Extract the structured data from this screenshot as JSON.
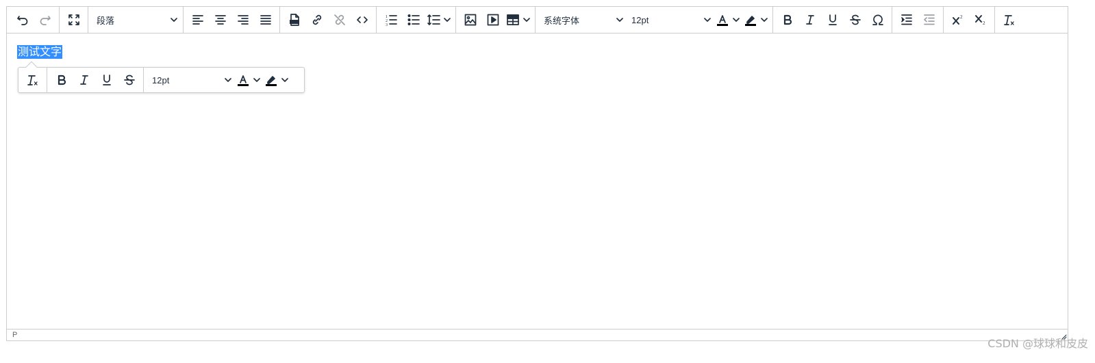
{
  "toolbar": {
    "block_format": "段落",
    "font_family": "系统字体",
    "font_size": "12pt"
  },
  "editor": {
    "selected_text": "测试文字"
  },
  "quickbar": {
    "font_size": "12pt"
  },
  "statusbar": {
    "path": "P"
  },
  "watermark": "CSDN @球球和皮皮",
  "colors": {
    "accent": "#338fff",
    "border": "#cccccc",
    "icon": "#222f3e"
  },
  "icons": [
    "undo-icon",
    "redo-icon",
    "fullscreen-icon",
    "align-left-icon",
    "align-center-icon",
    "align-right-icon",
    "align-justify-icon",
    "pdf-icon",
    "link-icon",
    "unlink-icon",
    "code-icon",
    "ordered-list-icon",
    "bullet-list-icon",
    "line-height-icon",
    "image-icon",
    "media-icon",
    "table-icon",
    "text-color-icon",
    "highlight-icon",
    "bold-icon",
    "italic-icon",
    "underline-icon",
    "strikethrough-icon",
    "omega-icon",
    "indent-icon",
    "outdent-icon",
    "superscript-icon",
    "subscript-icon",
    "clear-format-icon"
  ]
}
